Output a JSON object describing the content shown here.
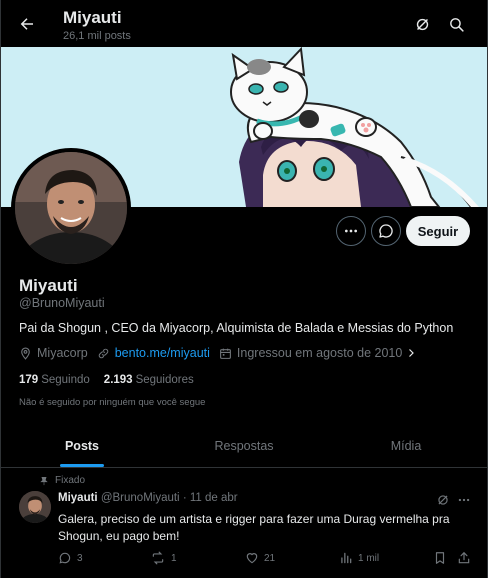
{
  "header": {
    "title": "Miyauti",
    "post_count": "26,1 mil posts"
  },
  "profile": {
    "name": "Miyauti",
    "handle": "@BrunoMiyauti",
    "bio": "Pai da Shogun , CEO da Miyacorp, Alquimista de Balada e Messias do Python",
    "location": "Miyacorp",
    "website": "bento.me/miyauti",
    "joined": "Ingressou em agosto de 2010",
    "following_count": "179",
    "following_label": "Seguindo",
    "followers_count": "2.193",
    "followers_label": "Seguidores",
    "not_followed_text": "Não é seguido por ninguém que você segue",
    "follow_label": "Seguir"
  },
  "tabs": [
    {
      "label": "Posts",
      "active": true
    },
    {
      "label": "Respostas",
      "active": false
    },
    {
      "label": "Mídia",
      "active": false
    }
  ],
  "pinned_tweet": {
    "pinned_label": "Fixado",
    "author_name": "Miyauti",
    "author_handle": "@BrunoMiyauti",
    "separator": "·",
    "date": "11 de abr",
    "text": "Galera,  preciso de um artista e rigger para fazer uma Durag vermelha pra Shogun, eu pago bem!",
    "replies": "3",
    "retweets": "1",
    "likes": "21",
    "views": "1 mil"
  },
  "colors": {
    "accent": "#1d9bf0",
    "background": "#000000",
    "muted_text": "#71767b",
    "banner_sky": "#cdeef5"
  },
  "icons": [
    "back-arrow-icon",
    "grok-icon",
    "search-icon",
    "more-icon",
    "message-icon",
    "location-icon",
    "link-icon",
    "calendar-icon",
    "chevron-right-icon",
    "pin-icon",
    "reply-icon",
    "retweet-icon",
    "like-icon",
    "views-icon",
    "bookmark-icon",
    "share-icon"
  ]
}
